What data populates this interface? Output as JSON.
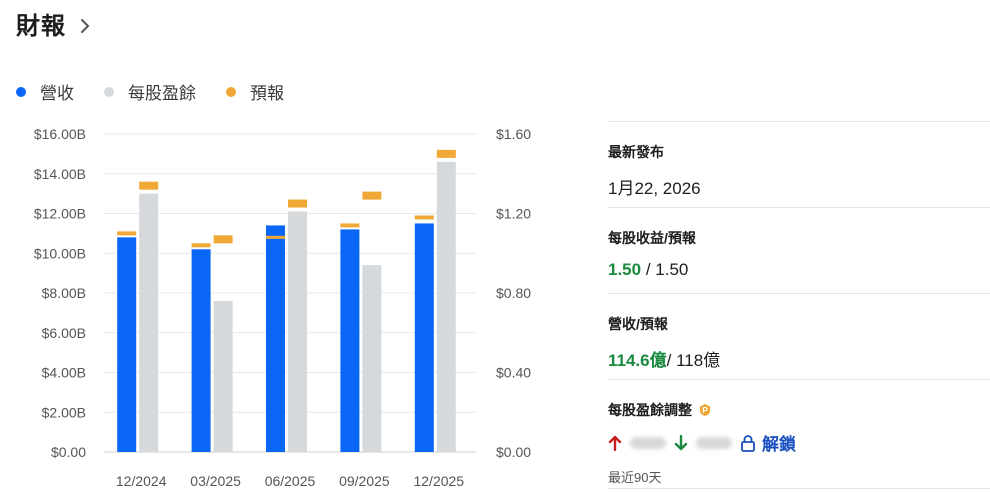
{
  "header": {
    "title": "財報"
  },
  "legend": [
    {
      "label": "營收",
      "color": "#0a66f5"
    },
    {
      "label": "每股盈餘",
      "color": "#d6d9dc"
    },
    {
      "label": "預報",
      "color": "#f0a837"
    }
  ],
  "chart_data": {
    "type": "bar",
    "categories": [
      "12/2024",
      "03/2025",
      "06/2025",
      "09/2025",
      "12/2025"
    ],
    "left_axis": {
      "ticks": [
        "$0.00",
        "$2.00B",
        "$4.00B",
        "$6.00B",
        "$8.00B",
        "$10.00B",
        "$12.00B",
        "$14.00B",
        "$16.00B"
      ],
      "ylim": [
        0,
        16
      ]
    },
    "right_axis": {
      "ticks": [
        "$0.00",
        "$0.40",
        "$0.80",
        "$1.20",
        "$1.60"
      ],
      "ylim": [
        0,
        1.6
      ]
    },
    "series": [
      {
        "name": "營收",
        "axis": "left",
        "values": [
          10.8,
          10.2,
          11.4,
          11.2,
          11.5
        ],
        "color": "#0a66f5"
      },
      {
        "name": "每股盈餘",
        "axis": "right",
        "values": [
          1.3,
          0.76,
          1.21,
          0.94,
          1.46
        ],
        "color": "#d6d9dc"
      },
      {
        "name": "預報",
        "axis": "left",
        "values": [
          11.0,
          10.4,
          10.8,
          11.4,
          11.8
        ],
        "color": "#f0a837",
        "of": "營收"
      },
      {
        "name": "預報",
        "axis": "right",
        "values": [
          1.34,
          1.07,
          1.25,
          1.29,
          1.5
        ],
        "color": "#f0a837",
        "of": "每股盈餘"
      }
    ],
    "grid": true
  },
  "panel": {
    "latest_label": "最新發布",
    "latest_value": "1月22, 2026",
    "eps_label": "每股收益/預報",
    "eps_actual": "1.50",
    "eps_sep": " / ",
    "eps_estimate": "1.50",
    "rev_label": "營收/預報",
    "rev_actual": "114.6億",
    "rev_sep": "/ ",
    "rev_estimate": "118億",
    "revision_label": "每股盈餘調整",
    "unlock_label": "解鎖",
    "period": "最近90天",
    "up_color": "#c8201f",
    "down_color": "#1a8a3e"
  }
}
